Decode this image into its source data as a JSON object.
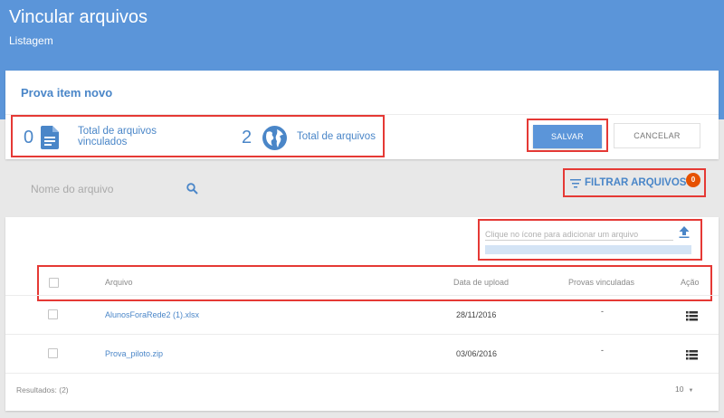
{
  "header": {
    "title": "Vincular arquivos",
    "subtitle": "Listagem"
  },
  "card": {
    "title": "Prova item novo"
  },
  "stats": {
    "linked_count": "0",
    "linked_label_line1": "Total de arquivos",
    "linked_label_line2": "vinculados",
    "linked_icon": "document-icon",
    "total_count": "2",
    "total_label": "Total de arquivos",
    "total_icon": "globe-icon"
  },
  "actions": {
    "save_label": "SALVAR",
    "cancel_label": "CANCELAR"
  },
  "search": {
    "placeholder": "Nome do arquivo",
    "value": "",
    "icon": "search-icon"
  },
  "filter": {
    "label": "FILTRAR ARQUIVOS",
    "badge": "0",
    "icon": "filter-icon"
  },
  "upload": {
    "placeholder": "Clique no ícone para adicionar um arquivo",
    "value": "",
    "icon": "upload-icon",
    "progress": 0
  },
  "table": {
    "columns": {
      "file": "Arquivo",
      "date": "Data de upload",
      "linked": "Provas vinculadas",
      "action": "Ação"
    },
    "rows": [
      {
        "file": "AlunosForaRede2 (1).xlsx",
        "date": "28/11/2016",
        "linked": "-",
        "action_icon": "list-icon"
      },
      {
        "file": "Prova_piloto.zip",
        "date": "03/06/2016",
        "linked": "-",
        "action_icon": "list-icon"
      }
    ]
  },
  "footer": {
    "results": "Resultados: (2)",
    "page_size": "10"
  },
  "colors": {
    "header_bg": "#5b95d9",
    "accent": "#4a86c8",
    "badge": "#e65100",
    "highlight": "#e53935"
  }
}
